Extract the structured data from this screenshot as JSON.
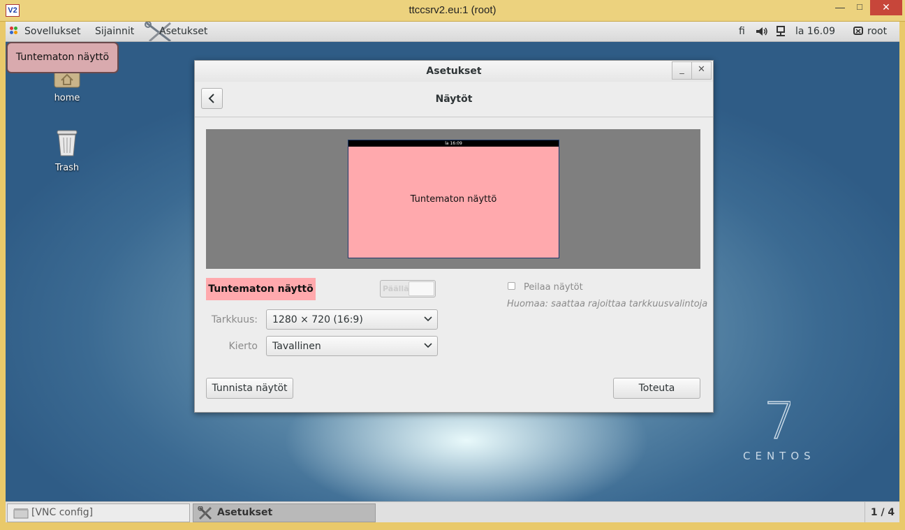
{
  "vnc_window": {
    "title": "ttccsrv2.eu:1 (root)",
    "logo_text": "V2",
    "min_glyph": "—",
    "max_glyph": "□",
    "close_glyph": "✕"
  },
  "topbar": {
    "applications": "Sovellukset",
    "places": "Sijainnit",
    "active_app": "Asetukset",
    "input_lang": "fi",
    "clock": "la 16.09",
    "user": "root"
  },
  "notification": {
    "text": "Tuntematon näyttö"
  },
  "desktop_icons": {
    "home": "home",
    "trash": "Trash"
  },
  "brand": {
    "version": "7",
    "name": "CENTOS"
  },
  "dialog": {
    "title": "Asetukset",
    "minimize_glyph": "_",
    "close_glyph": "✕",
    "heading": "Näytöt",
    "preview": {
      "topbar_clock": "la 16:09",
      "monitor_label": "Tuntematon näyttö",
      "monitor_color": "#ffa9ad"
    },
    "display_name": "Tuntematon näyttö",
    "power_toggle": {
      "label": "Päällä",
      "on": true
    },
    "mirror": {
      "label": "Peilaa näytöt",
      "checked": false,
      "note": "Huomaa: saattaa rajoittaa tarkkuusvalintoja"
    },
    "resolution": {
      "label": "Tarkkuus:",
      "value": "1280 × 720 (16:9)"
    },
    "rotation": {
      "label": "Kierto",
      "value": "Tavallinen"
    },
    "detect_button": "Tunnista näytöt",
    "apply_button": "Toteuta"
  },
  "taskbar": {
    "vnc_config": "[VNC config]",
    "settings": "Asetukset",
    "workspace": "1 / 4"
  }
}
